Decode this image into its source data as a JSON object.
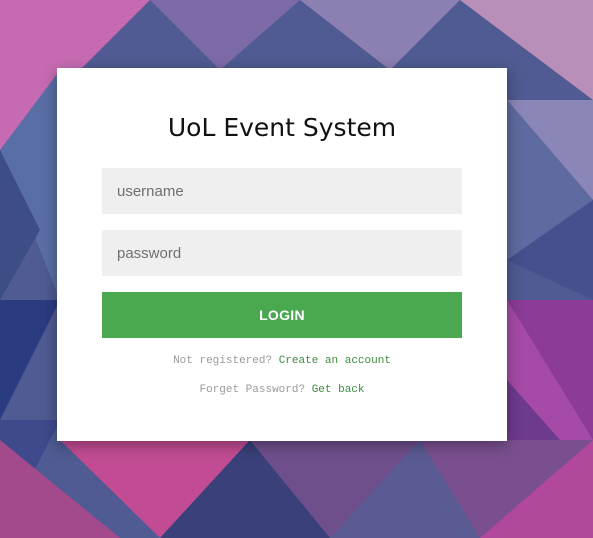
{
  "app": {
    "title": "UoL Event System"
  },
  "form": {
    "username_placeholder": "username",
    "password_placeholder": "password",
    "login_label": "LOGIN"
  },
  "links": {
    "not_registered_text": "Not registered?",
    "create_account_label": "Create an account",
    "forget_password_text": "Forget Password?",
    "get_back_label": "Get back"
  },
  "colors": {
    "accent": "#4aa84f",
    "link": "#3c8d3f",
    "card_bg": "#ffffff",
    "input_bg": "#efefef"
  }
}
